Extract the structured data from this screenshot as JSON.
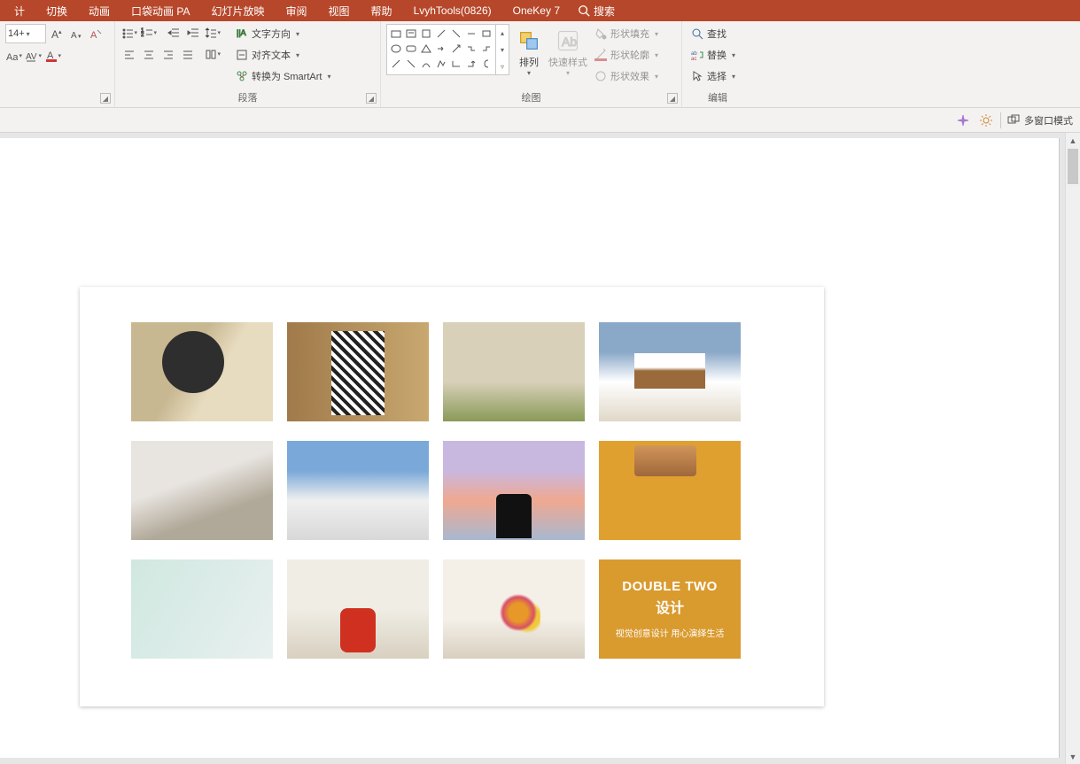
{
  "menu": {
    "items": [
      "计",
      "切换",
      "动画",
      "口袋动画 PA",
      "幻灯片放映",
      "审阅",
      "视图",
      "帮助",
      "LvyhTools(0826)",
      "OneKey 7"
    ],
    "search_placeholder": "搜索"
  },
  "ribbon": {
    "font": {
      "size": "14+"
    },
    "paragraph": {
      "label": "段落",
      "text_direction": "文字方向",
      "align_text": "对齐文本",
      "convert_smartart": "转换为 SmartArt"
    },
    "drawing": {
      "label": "绘图",
      "arrange": "排列",
      "quick_styles": "快速样式",
      "shape_fill": "形状填充",
      "shape_outline": "形状轮廓",
      "shape_effects": "形状效果"
    },
    "editing": {
      "label": "编辑",
      "find": "查找",
      "replace": "替换",
      "select": "选择"
    }
  },
  "status_strip": {
    "multi_window": "多窗口模式"
  },
  "slide": {
    "card": {
      "line1": "DOUBLE TWO",
      "line2": "设计",
      "line3": "视觉创意设计  用心演绎生活"
    }
  }
}
